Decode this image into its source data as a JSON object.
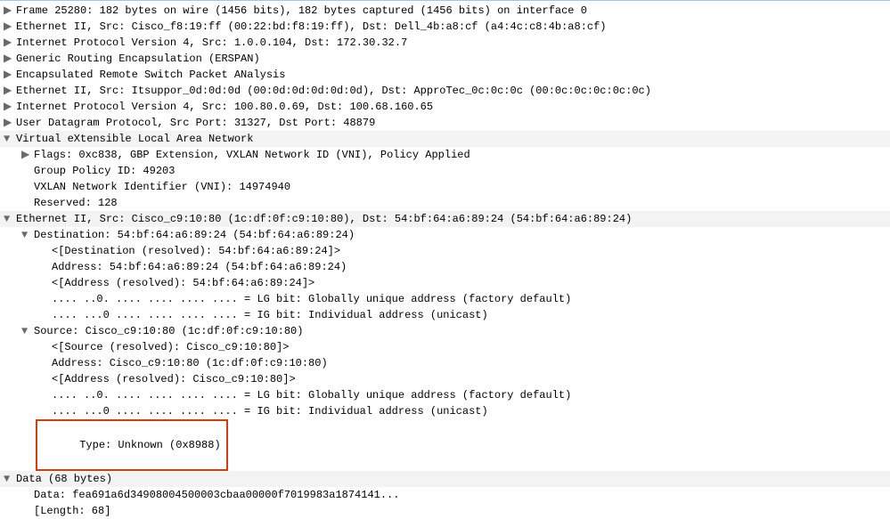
{
  "protocolTree": {
    "frame": "Frame 25280: 182 bytes on wire (1456 bits), 182 bytes captured (1456 bits) on interface 0",
    "eth1": "Ethernet II, Src: Cisco_f8:19:ff (00:22:bd:f8:19:ff), Dst: Dell_4b:a8:cf (a4:4c:c8:4b:a8:cf)",
    "ip1": "Internet Protocol Version 4, Src: 1.0.0.104, Dst: 172.30.32.7",
    "gre": "Generic Routing Encapsulation (ERSPAN)",
    "erspan": "Encapsulated Remote Switch Packet ANalysis",
    "eth2": "Ethernet II, Src: Itsuppor_0d:0d:0d (00:0d:0d:0d:0d:0d), Dst: ApproTec_0c:0c:0c (00:0c:0c:0c:0c:0c)",
    "ip2": "Internet Protocol Version 4, Src: 100.80.0.69, Dst: 100.68.160.65",
    "udp": "User Datagram Protocol, Src Port: 31327, Dst Port: 48879",
    "vxlan": {
      "header": "Virtual eXtensible Local Area Network",
      "flags": "Flags: 0xc838, GBP Extension, VXLAN Network ID (VNI), Policy Applied",
      "gpid": "Group Policy ID: 49203",
      "vni": "VXLAN Network Identifier (VNI): 14974940",
      "reserved": "Reserved: 128"
    },
    "eth3": {
      "header": "Ethernet II, Src: Cisco_c9:10:80 (1c:df:0f:c9:10:80), Dst: 54:bf:64:a6:89:24 (54:bf:64:a6:89:24)",
      "dst": {
        "header": "Destination: 54:bf:64:a6:89:24 (54:bf:64:a6:89:24)",
        "resolved": "<[Destination (resolved): 54:bf:64:a6:89:24]>",
        "addr": "Address: 54:bf:64:a6:89:24 (54:bf:64:a6:89:24)",
        "addrres": "<[Address (resolved): 54:bf:64:a6:89:24]>",
        "lg": ".... ..0. .... .... .... .... = LG bit: Globally unique address (factory default)",
        "ig": ".... ...0 .... .... .... .... = IG bit: Individual address (unicast)"
      },
      "src": {
        "header": "Source: Cisco_c9:10:80 (1c:df:0f:c9:10:80)",
        "resolved": "<[Source (resolved): Cisco_c9:10:80]>",
        "addr": "Address: Cisco_c9:10:80 (1c:df:0f:c9:10:80)",
        "addrres": "<[Address (resolved): Cisco_c9:10:80]>",
        "lg": ".... ..0. .... .... .... .... = LG bit: Globally unique address (factory default)",
        "ig": ".... ...0 .... .... .... .... = IG bit: Individual address (unicast)"
      },
      "type": "Type: Unknown (0x8988)"
    },
    "data": {
      "header": "Data (68 bytes)",
      "hex": "Data: fea691a6d34908004500003cbaa00000f7019983a1874141...",
      "len": "[Length: 68]"
    }
  }
}
